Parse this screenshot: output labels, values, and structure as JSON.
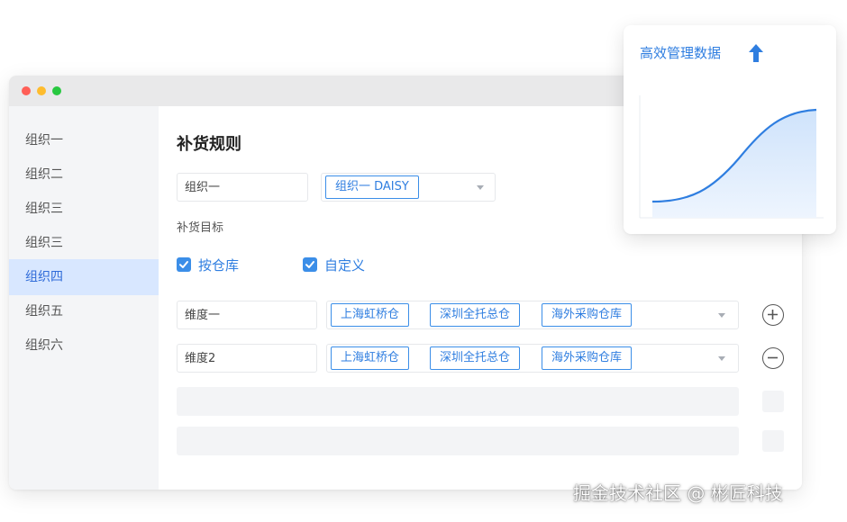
{
  "sidebar": {
    "items": [
      {
        "label": "组织一"
      },
      {
        "label": "组织二"
      },
      {
        "label": "组织三"
      },
      {
        "label": "组织三"
      },
      {
        "label": "组织四",
        "active": true
      },
      {
        "label": "组织五"
      },
      {
        "label": "组织六"
      }
    ]
  },
  "main": {
    "title": "补货规则",
    "org_input": "组织一",
    "org_select_tag": "组织一 DAISY",
    "target_label": "补货目标",
    "checkboxes": [
      {
        "label": "按仓库",
        "checked": true
      },
      {
        "label": "自定义",
        "checked": true
      }
    ],
    "dimensions": [
      {
        "name": "维度一",
        "tags": [
          "上海虹桥仓",
          "深圳全托总仓",
          "海外采购仓库"
        ],
        "action": "add"
      },
      {
        "name": "维度2",
        "tags": [
          "上海虹桥仓",
          "深圳全托总仓",
          "海外采购仓库"
        ],
        "action": "remove"
      }
    ]
  },
  "card": {
    "title": "高效管理数据",
    "icon": "arrow-up-icon",
    "accent": "#2f7ee0"
  },
  "watermark": "掘金技术社区 @ 彬匠科技",
  "colors": {
    "accent": "#3b8ee8",
    "sidebar_active_bg": "#d8e7ff",
    "window_dots": [
      "#ff5f57",
      "#febc2e",
      "#28c840"
    ]
  }
}
